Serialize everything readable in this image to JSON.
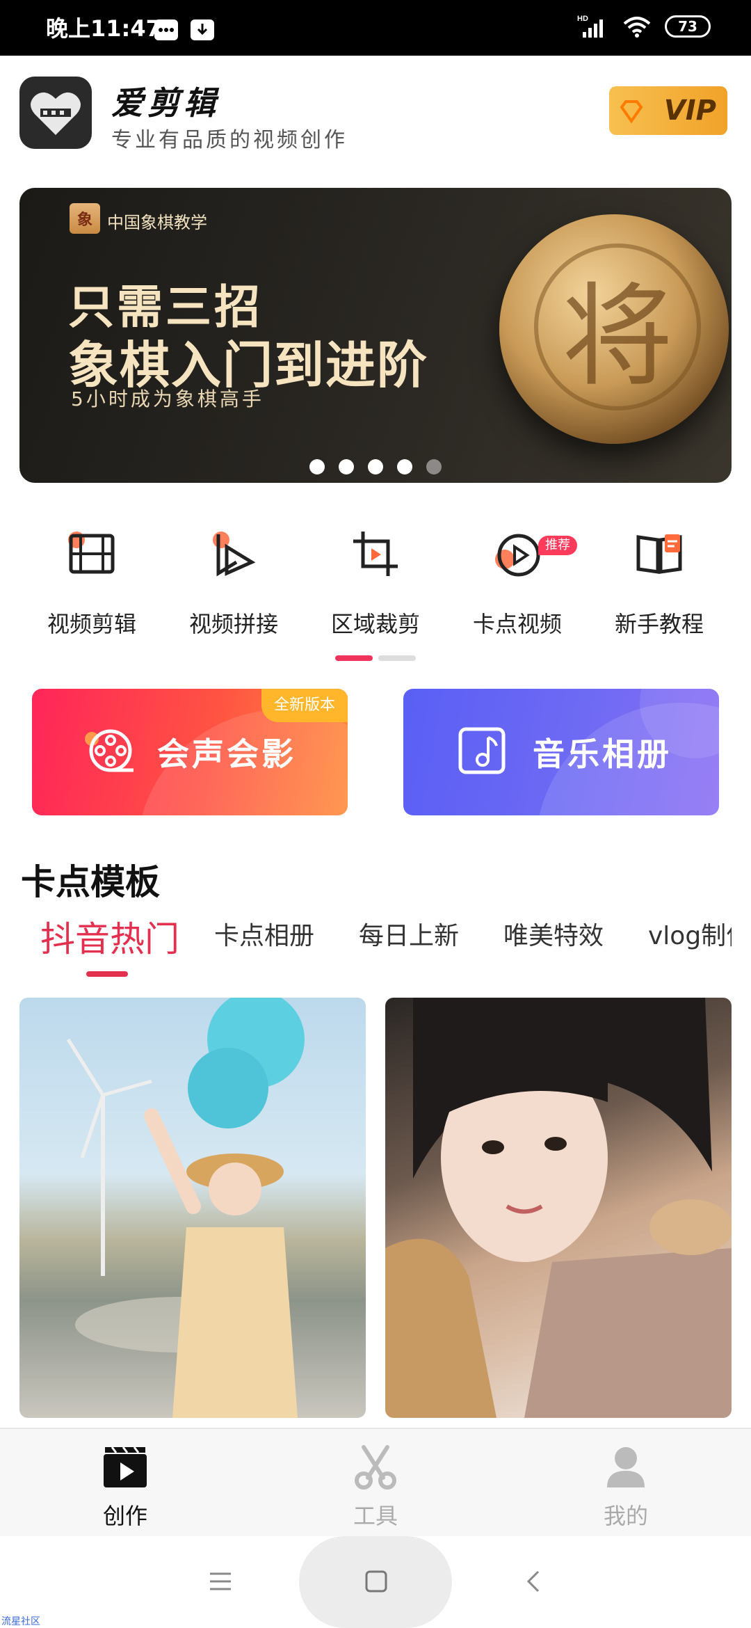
{
  "status_bar": {
    "time": "晚上11:47",
    "network": "HD",
    "battery": "73"
  },
  "header": {
    "app_name": "爱剪辑",
    "tagline": "专业有品质的视频创作",
    "vip_label": "VIP"
  },
  "banner": {
    "brand": "中国象棋教学",
    "brand_icon_char": "象",
    "headline_1": "只需三招",
    "headline_2": "象棋入门到进阶",
    "subline": "5小时成为象棋高手",
    "piece_char": "将",
    "slide_count": 5,
    "active_slide": 5
  },
  "tools": [
    {
      "label": "视频剪辑",
      "icon": "film-edit-icon"
    },
    {
      "label": "视频拼接",
      "icon": "video-join-icon"
    },
    {
      "label": "区域裁剪",
      "icon": "crop-icon"
    },
    {
      "label": "卡点视频",
      "icon": "beat-video-icon",
      "badge": "推荐"
    },
    {
      "label": "新手教程",
      "icon": "tutorial-book-icon"
    }
  ],
  "feature_cards": {
    "video_studio": {
      "title": "会声会影",
      "tag": "全新版本"
    },
    "music_album": {
      "title": "音乐相册"
    }
  },
  "templates": {
    "section_title": "卡点模板",
    "categories": [
      "抖音热门",
      "卡点相册",
      "每日上新",
      "唯美特效",
      "vlog制作"
    ],
    "active_category": "抖音热门"
  },
  "bottom_nav": [
    {
      "label": "创作",
      "icon": "create-icon",
      "active": true
    },
    {
      "label": "工具",
      "icon": "scissors-icon",
      "active": false
    },
    {
      "label": "我的",
      "icon": "profile-icon",
      "active": false
    }
  ],
  "watermark": "流星社区",
  "colors": {
    "accent": "#e3304f",
    "vip_gold": "#f1a229",
    "card_red": "#ff2559",
    "card_purple": "#6e6af4"
  }
}
